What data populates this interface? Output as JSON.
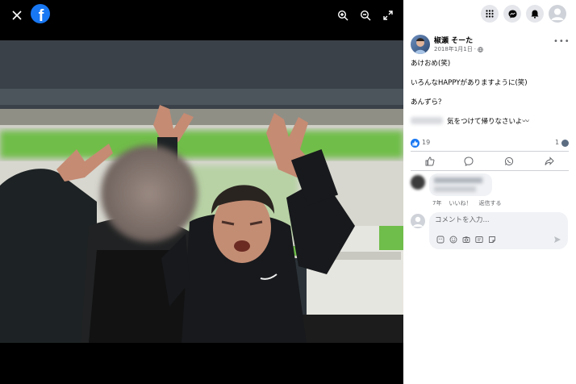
{
  "viewer": {
    "brand_letter": "f"
  },
  "post": {
    "author": "椒瀬 そーた",
    "date": "2018年1月1日",
    "lines": [
      "あけおめ(笑)",
      "いろんなHAPPYがありますように(笑)",
      "あんずら？",
      "気をつけて帰りなさいよ〰"
    ],
    "like_count": "19",
    "comment_count": "1"
  },
  "comment": {
    "age": "7年",
    "like_label": "いいね！",
    "reply_label": "返信する"
  },
  "composer": {
    "placeholder": "コメントを入力..."
  },
  "colors": {
    "brand": "#1877f2",
    "muted": "#65676b",
    "panel_bg": "#ffffff",
    "viewer_bg": "#000000"
  }
}
